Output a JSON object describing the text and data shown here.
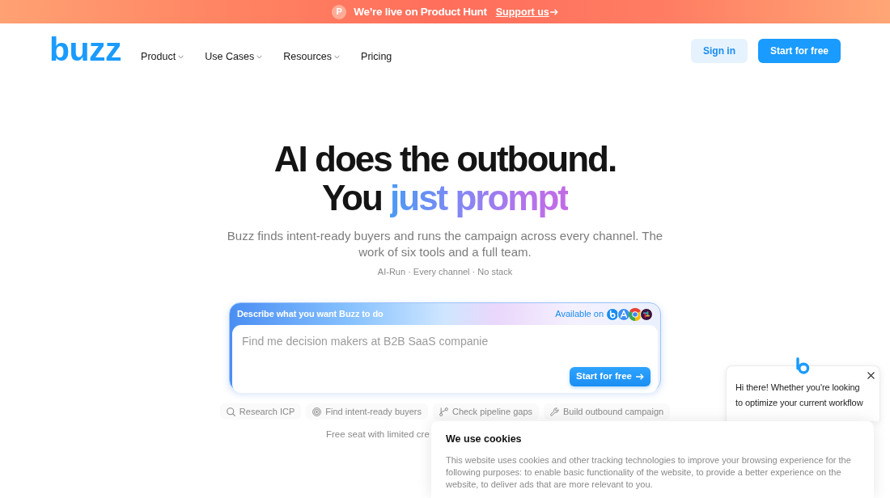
{
  "announcement": {
    "badge": "P",
    "text": "We’re live on Product Hunt",
    "link": "Support us"
  },
  "nav": {
    "logo": "buzz",
    "items": [
      {
        "label": "Product",
        "dropdown": true
      },
      {
        "label": "Use Cases",
        "dropdown": true
      },
      {
        "label": "Resources",
        "dropdown": true
      },
      {
        "label": "Pricing",
        "dropdown": false
      }
    ],
    "buttons": [
      {
        "label": "Sign in",
        "kind": "secondary"
      },
      {
        "label": "Start for free",
        "kind": "primary"
      }
    ]
  },
  "hero": {
    "title_lines": [
      [
        {
          "text": "AI does the outbound.",
          "gradient": false
        }
      ],
      [
        {
          "text": "You",
          "gradient": false
        },
        {
          "text": "just prompt",
          "gradient": true
        }
      ]
    ],
    "subtitle": "Buzz finds intent-ready buyers and runs the campaign across every channel. The work of six tools and a full team.",
    "tagline": "AI-Run · Every channel · No stack"
  },
  "prompt_box": {
    "header": "Describe what you want Buzz to do",
    "available_label": "Available on",
    "placeholder": "Find me decision makers at B2B SaaS companie",
    "button": "Start for free"
  },
  "suggestions": [
    {
      "label": "Research ICP"
    },
    {
      "label": "Find intent-ready buyers"
    },
    {
      "label": "Check pipeline gaps"
    },
    {
      "label": "Build outbound campaign"
    }
  ],
  "note": "Free seat with limited cre",
  "chat_popup": {
    "message": "Hi there! Whether you're looking to optimize your current workflow"
  },
  "cookie_banner": {
    "title": "We use cookies",
    "text": "This website uses cookies and other tracking technologies to improve your browsing experience for the following purposes: to enable basic functionality of the website, to provide a better experience on the website, to deliver ads that are more relevant to you."
  }
}
